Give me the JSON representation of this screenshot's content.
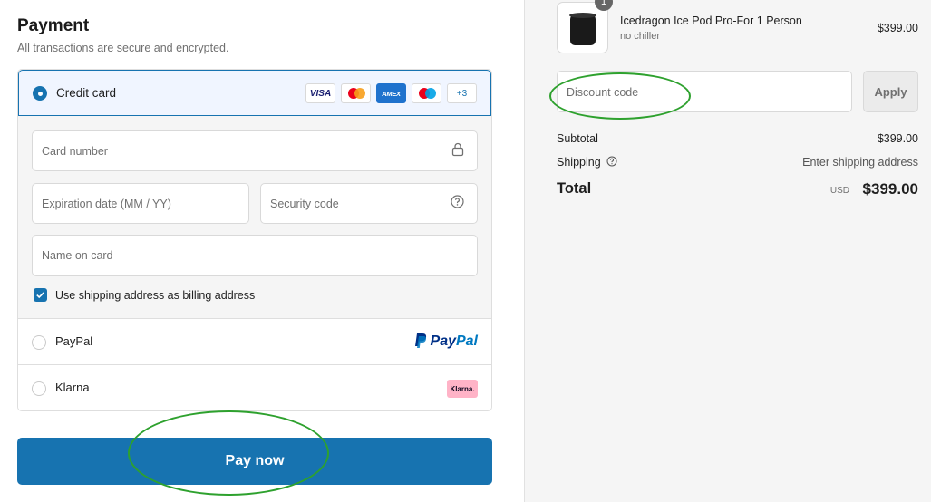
{
  "payment": {
    "title": "Payment",
    "subtitle": "All transactions are secure and encrypted.",
    "credit_card": {
      "label": "Credit card",
      "selected": true,
      "brands": [
        "VISA",
        "AMEX",
        "+3"
      ],
      "card_number_placeholder": "Card number",
      "expiry_placeholder": "Expiration date (MM / YY)",
      "security_placeholder": "Security code",
      "name_placeholder": "Name on card",
      "billing_same_label": "Use shipping address as billing address",
      "billing_same_checked": true
    },
    "paypal": {
      "label": "PayPal",
      "logo_pay": "Pay",
      "logo_pal": "Pal"
    },
    "klarna": {
      "label": "Klarna",
      "badge": "Klarna."
    },
    "pay_button": "Pay now"
  },
  "summary": {
    "item": {
      "quantity": "1",
      "name": "Icedragon Ice Pod Pro-For 1 Person",
      "variant": "no chiller",
      "price": "$399.00"
    },
    "discount_placeholder": "Discount code",
    "apply_label": "Apply",
    "subtotal_label": "Subtotal",
    "subtotal_value": "$399.00",
    "shipping_label": "Shipping",
    "shipping_value": "Enter shipping address",
    "total_label": "Total",
    "currency": "USD",
    "total_value": "$399.00"
  },
  "colors": {
    "accent": "#1773b0",
    "annotation": "#2ea12e",
    "klarna_pink": "#ffb3c7"
  }
}
